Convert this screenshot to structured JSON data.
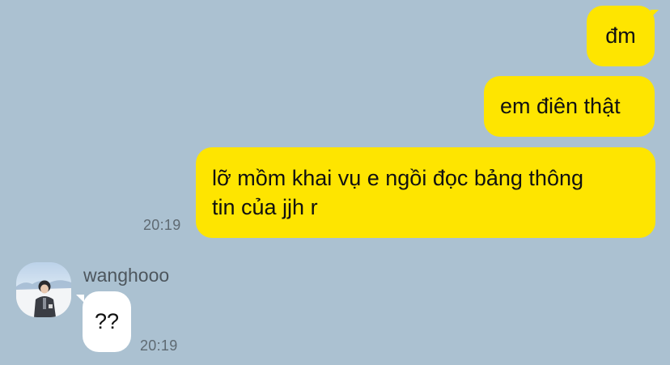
{
  "messages": {
    "out_1": "đm",
    "out_2": "em điên thật",
    "out_3_line1": "lỡ mồm khai vụ e ngồi đọc bảng thông",
    "out_3_line2": "tin của jjh r",
    "out_3_time": "20:19",
    "in_sender": "wanghooo",
    "in_1": "??",
    "in_1_time": "20:19"
  },
  "colors": {
    "background": "#abc1d1",
    "outgoing_bubble": "#fee500",
    "incoming_bubble": "#ffffff"
  },
  "icons": {
    "avatar": "user-photo-avatar"
  }
}
